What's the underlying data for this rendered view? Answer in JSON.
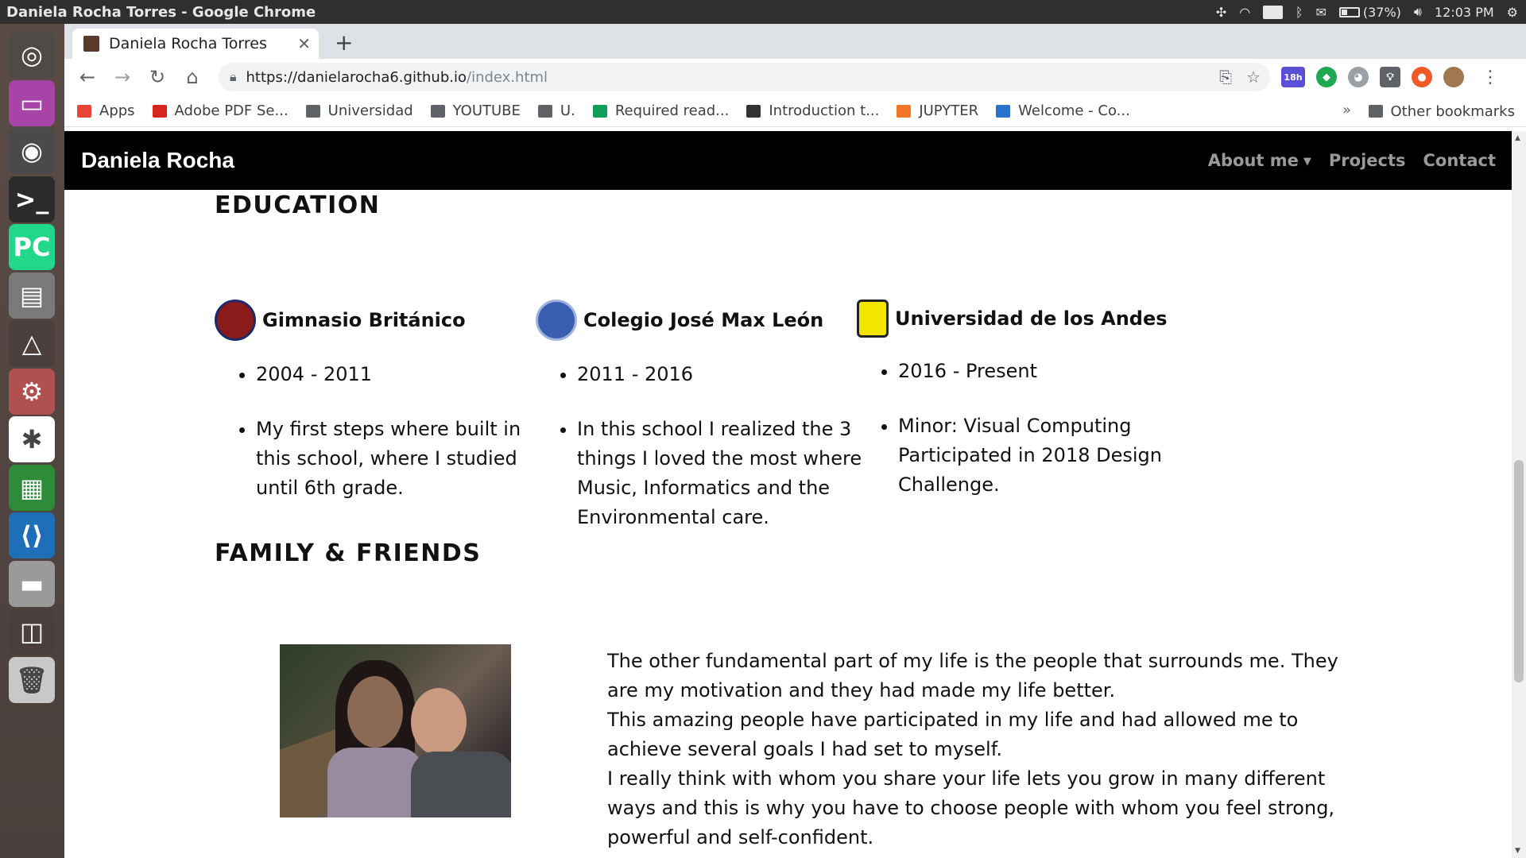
{
  "system": {
    "window_title": "Daniela Rocha Torres - Google Chrome",
    "language": "Es",
    "battery": "(37%)",
    "battery_fraction": 0.37,
    "clock": "12:03 PM"
  },
  "launcher": {
    "items": [
      {
        "name": "ubuntu-dash-icon",
        "color": "#4d4a48",
        "glyph": "◎"
      },
      {
        "name": "window-app-icon",
        "color": "#a844a8",
        "glyph": "▭"
      },
      {
        "name": "chrome-icon",
        "color": "#4a4a4a",
        "glyph": "◉"
      },
      {
        "name": "terminal-icon",
        "color": "#2b2b2b",
        "glyph": ">_"
      },
      {
        "name": "pycharm-icon",
        "color": "#21d789",
        "glyph": "PC"
      },
      {
        "name": "files-icon",
        "color": "#7a7a7a",
        "glyph": "▤"
      },
      {
        "name": "design-app-icon",
        "color": "#4a3f3c",
        "glyph": "△"
      },
      {
        "name": "settings-tool-icon",
        "color": "#b05050",
        "glyph": "⚙"
      },
      {
        "name": "slack-icon",
        "color": "#ffffff",
        "glyph": "✱"
      },
      {
        "name": "spreadsheet-icon",
        "color": "#2e8b3a",
        "glyph": "▦"
      },
      {
        "name": "vscode-icon",
        "color": "#1f6fb8",
        "glyph": "⟨⟩"
      },
      {
        "name": "disk-icon",
        "color": "#9a9a9a",
        "glyph": "▬"
      },
      {
        "name": "workspace-icon",
        "color": "#4a3f3c",
        "glyph": "◫"
      },
      {
        "name": "trash-icon",
        "color": "#c8c8c8",
        "glyph": "🗑"
      }
    ]
  },
  "browser": {
    "tab_title": "Daniela Rocha Torres",
    "url_host": "https://danielarocha6.github.io",
    "url_path": "/index.html",
    "extension_badge": "18h",
    "bookmarks": [
      {
        "label": "Apps",
        "icon": "apps-grid-icon"
      },
      {
        "label": "Adobe PDF Se...",
        "icon": "adobe-icon"
      },
      {
        "label": "Universidad",
        "icon": "folder-icon"
      },
      {
        "label": "YOUTUBE",
        "icon": "folder-icon"
      },
      {
        "label": "U.",
        "icon": "folder-icon"
      },
      {
        "label": "Required read...",
        "icon": "green-plus-icon"
      },
      {
        "label": "Introduction t...",
        "icon": "course-icon"
      },
      {
        "label": "JUPYTER",
        "icon": "jupyter-icon"
      },
      {
        "label": "Welcome - Co...",
        "icon": "coursera-icon"
      }
    ],
    "other_bookmarks": "Other bookmarks"
  },
  "site": {
    "brand": "Daniela Rocha",
    "nav": {
      "about": "About me",
      "projects": "Projects",
      "contact": "Contact"
    },
    "education": {
      "title": "EDUCATION",
      "schools": [
        {
          "name": "Gimnasio Británico",
          "logo_color": "#8b1a1a",
          "years": "2004 - 2011",
          "desc": "My first steps where built in this school, where I studied until 6th grade."
        },
        {
          "name": "Colegio José Max León",
          "logo_color": "#3a5fb0",
          "years": "2011 - 2016",
          "desc": "In this school I realized the 3 things I loved the most where Music, Informatics and the Environmental care."
        },
        {
          "name": "Universidad de los Andes",
          "logo_color": "#f2e600",
          "years": "2016 - Present",
          "desc": "Minor: Visual Computing Participated in 2018 Design Challenge."
        }
      ]
    },
    "family": {
      "title": "FAMILY & FRIENDS",
      "paragraphs": [
        "The other fundamental part of my life is the people that surrounds me. They are my motivation and they had made my life better.",
        "This amazing people have participated in my life and had allowed me to achieve several goals I had set to myself.",
        "I really think with whom you share your life lets you grow in many different ways and this is why you have to choose people with whom you feel strong, powerful and self-confident."
      ]
    }
  }
}
